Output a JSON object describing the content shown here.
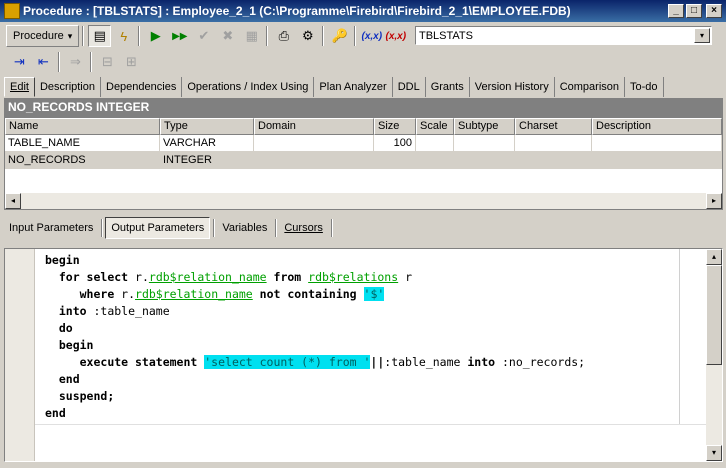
{
  "window": {
    "title": "Procedure : [TBLSTATS] : Employee_2_1 (C:\\Programme\\Firebird\\Firebird_2_1\\EMPLOYEE.FDB)",
    "min_label": "_",
    "max_label": "□",
    "close_label": "×"
  },
  "toolbar": {
    "procedure_label": "Procedure",
    "procedure_arrow": "▾",
    "procedure_combo_value": "TBLSTATS",
    "combo_arrow": "▾",
    "icon_compile": "▤",
    "icon_lightning": "ϟ",
    "icon_run": "▶",
    "icon_run_step": "▶▶",
    "icon_commit": "✔",
    "icon_rollback": "✖",
    "icon_grid": "▦",
    "icon_print": "⎙",
    "icon_debug": "⚙",
    "icon_keys": "🔑",
    "icon_param_blue": "(x,x)",
    "icon_param_red": "(x,x)",
    "icon_indent": "⇥",
    "icon_outdent": "⇤",
    "icon_arrow_right": "⇒",
    "icon_comment": "⊟",
    "icon_uncomment": "⊞"
  },
  "tabs": [
    {
      "label": "Edit"
    },
    {
      "label": "Description"
    },
    {
      "label": "Dependencies"
    },
    {
      "label": "Operations / Index Using"
    },
    {
      "label": "Plan Analyzer"
    },
    {
      "label": "DDL"
    },
    {
      "label": "Grants"
    },
    {
      "label": "Version History"
    },
    {
      "label": "Comparison"
    },
    {
      "label": "To-do"
    }
  ],
  "section": {
    "title": "NO_RECORDS INTEGER"
  },
  "grid": {
    "columns": [
      "Name",
      "Type",
      "Domain",
      "Size",
      "Scale",
      "Subtype",
      "Charset",
      "Description"
    ],
    "rows": [
      {
        "name": "TABLE_NAME",
        "type": "VARCHAR",
        "domain": "",
        "size": "100",
        "scale": "",
        "subtype": "",
        "charset": "",
        "description": ""
      },
      {
        "name": "NO_RECORDS",
        "type": "INTEGER",
        "domain": "",
        "size": "",
        "scale": "",
        "subtype": "",
        "charset": "",
        "description": ""
      }
    ],
    "scroll_left": "◂",
    "scroll_right": "▸"
  },
  "param_tabs": [
    {
      "label": "Input Parameters"
    },
    {
      "label": "Output Parameters"
    },
    {
      "label": "Variables"
    },
    {
      "label": "Cursors"
    }
  ],
  "code": {
    "l1_kw": "begin",
    "l2_kw1": "for select",
    "l2_t1": " r.",
    "l2_db1": "rdb$relation_name",
    "l2_kw2": " from ",
    "l2_db2": "rdb$relations",
    "l2_t2": " r",
    "l3_kw1": "where",
    "l3_t1": " r.",
    "l3_db1": "rdb$relation_name",
    "l3_kw2": " not containing ",
    "l3_str": "'$'",
    "l4_kw": "into",
    "l4_t": " :table_name",
    "l5_kw": "do",
    "l6_kw": "begin",
    "l7_kw": "execute statement ",
    "l7_str": "'select count (*) from '",
    "l7_op": "||",
    "l7_t1": ":table_name ",
    "l7_kw2": "into",
    "l7_t2": " :no_records;",
    "l8_kw": "end",
    "l9_kw": "suspend;",
    "l10_kw": "end"
  },
  "editor": {
    "scroll_up": "▴",
    "scroll_down": "▾"
  }
}
